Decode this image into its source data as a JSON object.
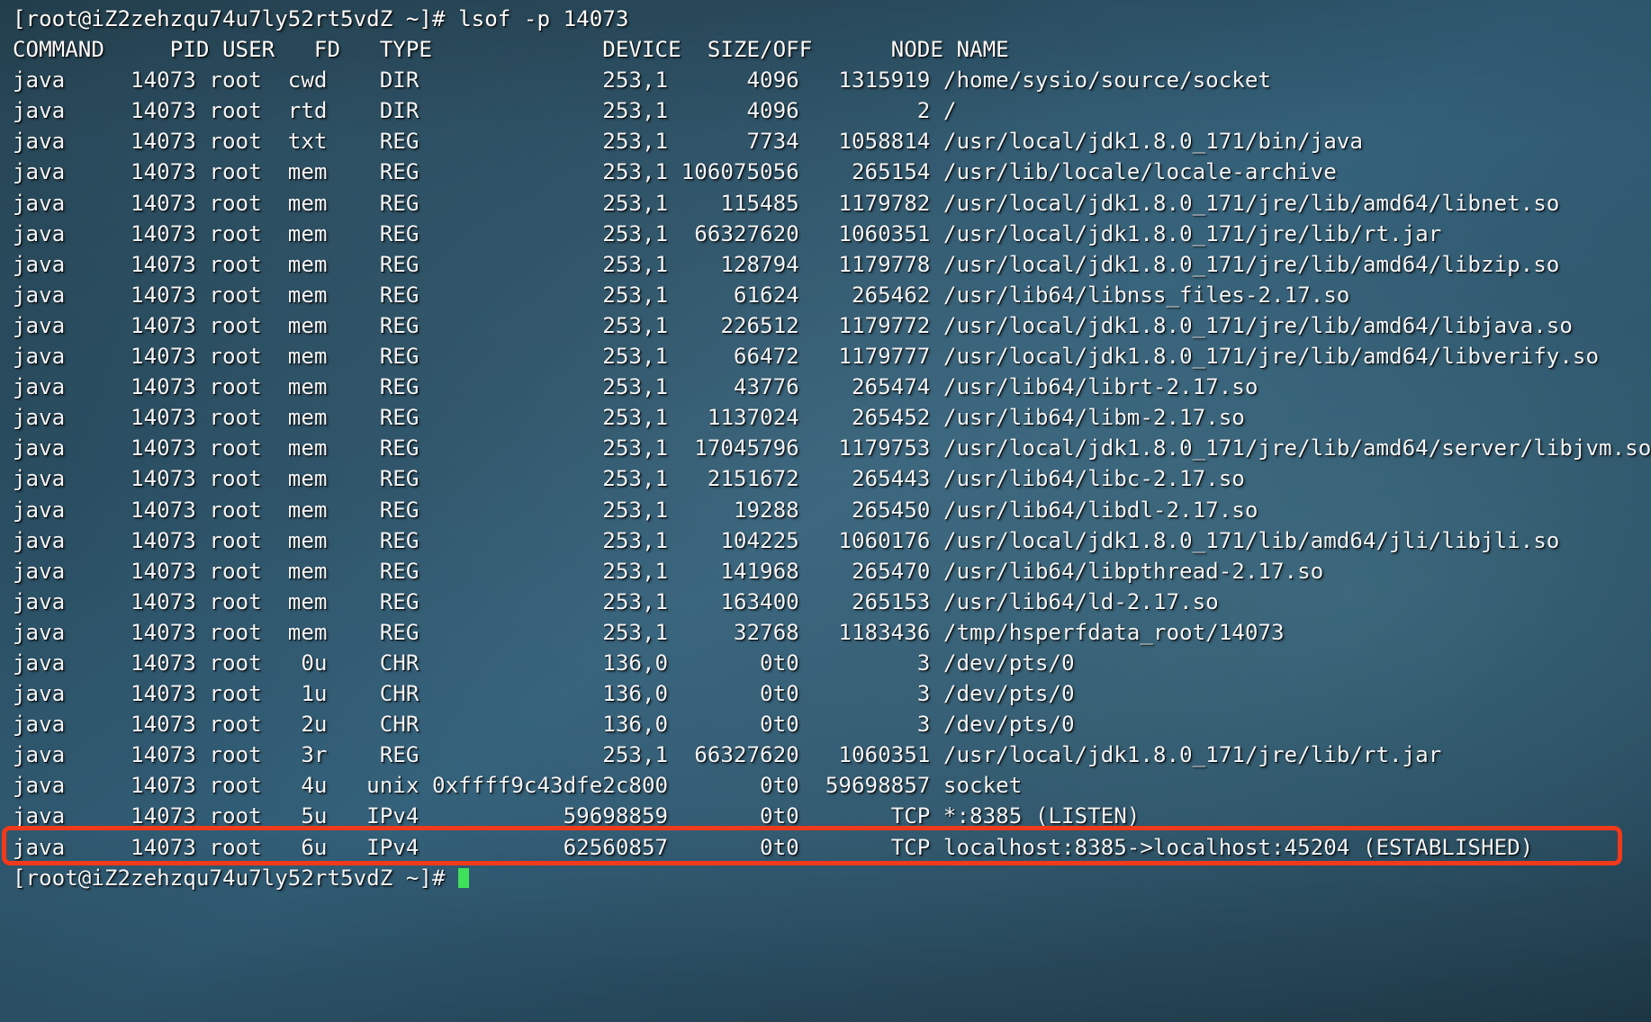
{
  "terminal": {
    "prompt": "[root@iZ2zehzqu74u7ly52rt5vdZ ~]# ",
    "command": "lsof -p 14073",
    "prompt_line": "[root@iZ2zehzqu74u7ly52rt5vdZ ~]# lsof -p 14073",
    "next_prompt": "[root@iZ2zehzqu74u7ly52rt5vdZ ~]# ",
    "columns": [
      "COMMAND",
      "PID",
      "USER",
      "FD",
      "TYPE",
      "DEVICE",
      "SIZE/OFF",
      "NODE",
      "NAME"
    ],
    "header_line": "COMMAND     PID USER   FD   TYPE             DEVICE  SIZE/OFF      NODE NAME",
    "highlight_color": "#f13a1c",
    "cursor_color": "#3fe05a",
    "text_color": "#f2f6f8",
    "rows": [
      {
        "command": "java",
        "pid": "14073",
        "user": "root",
        "fd": "cwd",
        "type": "DIR",
        "device": "253,1",
        "size_off": "4096",
        "node": "1315919",
        "name": "/home/sysio/source/socket",
        "highlighted": false
      },
      {
        "command": "java",
        "pid": "14073",
        "user": "root",
        "fd": "rtd",
        "type": "DIR",
        "device": "253,1",
        "size_off": "4096",
        "node": "2",
        "name": "/",
        "highlighted": false
      },
      {
        "command": "java",
        "pid": "14073",
        "user": "root",
        "fd": "txt",
        "type": "REG",
        "device": "253,1",
        "size_off": "7734",
        "node": "1058814",
        "name": "/usr/local/jdk1.8.0_171/bin/java",
        "highlighted": false
      },
      {
        "command": "java",
        "pid": "14073",
        "user": "root",
        "fd": "mem",
        "type": "REG",
        "device": "253,1",
        "size_off": "106075056",
        "node": "265154",
        "name": "/usr/lib/locale/locale-archive",
        "highlighted": false
      },
      {
        "command": "java",
        "pid": "14073",
        "user": "root",
        "fd": "mem",
        "type": "REG",
        "device": "253,1",
        "size_off": "115485",
        "node": "1179782",
        "name": "/usr/local/jdk1.8.0_171/jre/lib/amd64/libnet.so",
        "highlighted": false
      },
      {
        "command": "java",
        "pid": "14073",
        "user": "root",
        "fd": "mem",
        "type": "REG",
        "device": "253,1",
        "size_off": "66327620",
        "node": "1060351",
        "name": "/usr/local/jdk1.8.0_171/jre/lib/rt.jar",
        "highlighted": false
      },
      {
        "command": "java",
        "pid": "14073",
        "user": "root",
        "fd": "mem",
        "type": "REG",
        "device": "253,1",
        "size_off": "128794",
        "node": "1179778",
        "name": "/usr/local/jdk1.8.0_171/jre/lib/amd64/libzip.so",
        "highlighted": false
      },
      {
        "command": "java",
        "pid": "14073",
        "user": "root",
        "fd": "mem",
        "type": "REG",
        "device": "253,1",
        "size_off": "61624",
        "node": "265462",
        "name": "/usr/lib64/libnss_files-2.17.so",
        "highlighted": false
      },
      {
        "command": "java",
        "pid": "14073",
        "user": "root",
        "fd": "mem",
        "type": "REG",
        "device": "253,1",
        "size_off": "226512",
        "node": "1179772",
        "name": "/usr/local/jdk1.8.0_171/jre/lib/amd64/libjava.so",
        "highlighted": false
      },
      {
        "command": "java",
        "pid": "14073",
        "user": "root",
        "fd": "mem",
        "type": "REG",
        "device": "253,1",
        "size_off": "66472",
        "node": "1179777",
        "name": "/usr/local/jdk1.8.0_171/jre/lib/amd64/libverify.so",
        "highlighted": false
      },
      {
        "command": "java",
        "pid": "14073",
        "user": "root",
        "fd": "mem",
        "type": "REG",
        "device": "253,1",
        "size_off": "43776",
        "node": "265474",
        "name": "/usr/lib64/librt-2.17.so",
        "highlighted": false
      },
      {
        "command": "java",
        "pid": "14073",
        "user": "root",
        "fd": "mem",
        "type": "REG",
        "device": "253,1",
        "size_off": "1137024",
        "node": "265452",
        "name": "/usr/lib64/libm-2.17.so",
        "highlighted": false
      },
      {
        "command": "java",
        "pid": "14073",
        "user": "root",
        "fd": "mem",
        "type": "REG",
        "device": "253,1",
        "size_off": "17045796",
        "node": "1179753",
        "name": "/usr/local/jdk1.8.0_171/jre/lib/amd64/server/libjvm.so",
        "highlighted": false
      },
      {
        "command": "java",
        "pid": "14073",
        "user": "root",
        "fd": "mem",
        "type": "REG",
        "device": "253,1",
        "size_off": "2151672",
        "node": "265443",
        "name": "/usr/lib64/libc-2.17.so",
        "highlighted": false
      },
      {
        "command": "java",
        "pid": "14073",
        "user": "root",
        "fd": "mem",
        "type": "REG",
        "device": "253,1",
        "size_off": "19288",
        "node": "265450",
        "name": "/usr/lib64/libdl-2.17.so",
        "highlighted": false
      },
      {
        "command": "java",
        "pid": "14073",
        "user": "root",
        "fd": "mem",
        "type": "REG",
        "device": "253,1",
        "size_off": "104225",
        "node": "1060176",
        "name": "/usr/local/jdk1.8.0_171/lib/amd64/jli/libjli.so",
        "highlighted": false
      },
      {
        "command": "java",
        "pid": "14073",
        "user": "root",
        "fd": "mem",
        "type": "REG",
        "device": "253,1",
        "size_off": "141968",
        "node": "265470",
        "name": "/usr/lib64/libpthread-2.17.so",
        "highlighted": false
      },
      {
        "command": "java",
        "pid": "14073",
        "user": "root",
        "fd": "mem",
        "type": "REG",
        "device": "253,1",
        "size_off": "163400",
        "node": "265153",
        "name": "/usr/lib64/ld-2.17.so",
        "highlighted": false
      },
      {
        "command": "java",
        "pid": "14073",
        "user": "root",
        "fd": "mem",
        "type": "REG",
        "device": "253,1",
        "size_off": "32768",
        "node": "1183436",
        "name": "/tmp/hsperfdata_root/14073",
        "highlighted": false
      },
      {
        "command": "java",
        "pid": "14073",
        "user": "root",
        "fd": "0u",
        "type": "CHR",
        "device": "136,0",
        "size_off": "0t0",
        "node": "3",
        "name": "/dev/pts/0",
        "highlighted": false
      },
      {
        "command": "java",
        "pid": "14073",
        "user": "root",
        "fd": "1u",
        "type": "CHR",
        "device": "136,0",
        "size_off": "0t0",
        "node": "3",
        "name": "/dev/pts/0",
        "highlighted": false
      },
      {
        "command": "java",
        "pid": "14073",
        "user": "root",
        "fd": "2u",
        "type": "CHR",
        "device": "136,0",
        "size_off": "0t0",
        "node": "3",
        "name": "/dev/pts/0",
        "highlighted": false
      },
      {
        "command": "java",
        "pid": "14073",
        "user": "root",
        "fd": "3r",
        "type": "REG",
        "device": "253,1",
        "size_off": "66327620",
        "node": "1060351",
        "name": "/usr/local/jdk1.8.0_171/jre/lib/rt.jar",
        "highlighted": false
      },
      {
        "command": "java",
        "pid": "14073",
        "user": "root",
        "fd": "4u",
        "type": "unix",
        "device": "0xffff9c43dfe2c800",
        "size_off": "0t0",
        "node": "59698857",
        "name": "socket",
        "highlighted": false
      },
      {
        "command": "java",
        "pid": "14073",
        "user": "root",
        "fd": "5u",
        "type": "IPv4",
        "device": "59698859",
        "size_off": "0t0",
        "node": "",
        "name": "TCP *:8385 (LISTEN)",
        "highlighted": false
      },
      {
        "command": "java",
        "pid": "14073",
        "user": "root",
        "fd": "6u",
        "type": "IPv4",
        "device": "62560857",
        "size_off": "0t0",
        "node": "",
        "name": "TCP localhost:8385->localhost:45204 (ESTABLISHED)",
        "highlighted": true
      }
    ],
    "rendered_lines": [
      "java     14073 root  cwd    DIR              253,1      4096   1315919 /home/sysio/source/socket",
      "java     14073 root  rtd    DIR              253,1      4096         2 /",
      "java     14073 root  txt    REG              253,1      7734   1058814 /usr/local/jdk1.8.0_171/bin/java",
      "java     14073 root  mem    REG              253,1 106075056    265154 /usr/lib/locale/locale-archive",
      "java     14073 root  mem    REG              253,1    115485   1179782 /usr/local/jdk1.8.0_171/jre/lib/amd64/libnet.so",
      "java     14073 root  mem    REG              253,1  66327620   1060351 /usr/local/jdk1.8.0_171/jre/lib/rt.jar",
      "java     14073 root  mem    REG              253,1    128794   1179778 /usr/local/jdk1.8.0_171/jre/lib/amd64/libzip.so",
      "java     14073 root  mem    REG              253,1     61624    265462 /usr/lib64/libnss_files-2.17.so",
      "java     14073 root  mem    REG              253,1    226512   1179772 /usr/local/jdk1.8.0_171/jre/lib/amd64/libjava.so",
      "java     14073 root  mem    REG              253,1     66472   1179777 /usr/local/jdk1.8.0_171/jre/lib/amd64/libverify.so",
      "java     14073 root  mem    REG              253,1     43776    265474 /usr/lib64/librt-2.17.so",
      "java     14073 root  mem    REG              253,1   1137024    265452 /usr/lib64/libm-2.17.so",
      "java     14073 root  mem    REG              253,1  17045796   1179753 /usr/local/jdk1.8.0_171/jre/lib/amd64/server/libjvm.so",
      "java     14073 root  mem    REG              253,1   2151672    265443 /usr/lib64/libc-2.17.so",
      "java     14073 root  mem    REG              253,1     19288    265450 /usr/lib64/libdl-2.17.so",
      "java     14073 root  mem    REG              253,1    104225   1060176 /usr/local/jdk1.8.0_171/lib/amd64/jli/libjli.so",
      "java     14073 root  mem    REG              253,1    141968    265470 /usr/lib64/libpthread-2.17.so",
      "java     14073 root  mem    REG              253,1    163400    265153 /usr/lib64/ld-2.17.so",
      "java     14073 root  mem    REG              253,1     32768   1183436 /tmp/hsperfdata_root/14073",
      "java     14073 root   0u    CHR              136,0       0t0         3 /dev/pts/0",
      "java     14073 root   1u    CHR              136,0       0t0         3 /dev/pts/0",
      "java     14073 root   2u    CHR              136,0       0t0         3 /dev/pts/0",
      "java     14073 root   3r    REG              253,1  66327620   1060351 /usr/local/jdk1.8.0_171/jre/lib/rt.jar",
      "java     14073 root   4u   unix 0xffff9c43dfe2c800       0t0  59698857 socket",
      "java     14073 root   5u   IPv4           59698859       0t0       TCP *:8385 (LISTEN)",
      "java     14073 root   6u   IPv4           62560857       0t0       TCP localhost:8385->localhost:45204 (ESTABLISHED)"
    ]
  }
}
